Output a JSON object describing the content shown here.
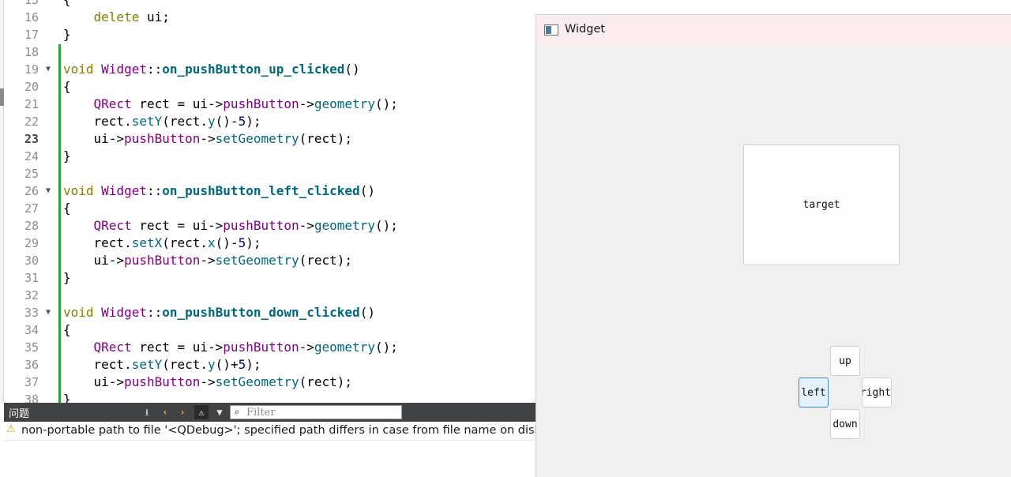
{
  "editor": {
    "current_line": "23",
    "lines": [
      {
        "n": "15",
        "fold": false,
        "tokens": [
          {
            "t": "{",
            "c": "op"
          }
        ]
      },
      {
        "n": "16",
        "fold": false,
        "tokens": [
          {
            "t": "    ",
            "c": "op"
          },
          {
            "t": "delete",
            "c": "kw"
          },
          {
            "t": " ui;",
            "c": "op"
          }
        ]
      },
      {
        "n": "17",
        "fold": false,
        "tokens": [
          {
            "t": "}",
            "c": "op"
          }
        ]
      },
      {
        "n": "18",
        "fold": false,
        "tokens": []
      },
      {
        "n": "19",
        "fold": true,
        "tokens": [
          {
            "t": "void",
            "c": "kw"
          },
          {
            "t": " ",
            "c": "op"
          },
          {
            "t": "Widget",
            "c": "ty"
          },
          {
            "t": "::",
            "c": "op"
          },
          {
            "t": "on_pushButton_up_clicked",
            "c": "fn"
          },
          {
            "t": "()",
            "c": "op"
          }
        ]
      },
      {
        "n": "20",
        "fold": false,
        "tokens": [
          {
            "t": "{",
            "c": "op"
          }
        ]
      },
      {
        "n": "21",
        "fold": false,
        "tokens": [
          {
            "t": "    ",
            "c": "op"
          },
          {
            "t": "QRect",
            "c": "ty"
          },
          {
            "t": " rect = ",
            "c": "op"
          },
          {
            "t": "ui",
            "c": "op"
          },
          {
            "t": "->",
            "c": "op"
          },
          {
            "t": "pushButton",
            "c": "ty"
          },
          {
            "t": "->",
            "c": "op"
          },
          {
            "t": "geometry",
            "c": "me"
          },
          {
            "t": "();",
            "c": "op"
          }
        ]
      },
      {
        "n": "22",
        "fold": false,
        "tokens": [
          {
            "t": "    rect.",
            "c": "op"
          },
          {
            "t": "setY",
            "c": "me"
          },
          {
            "t": "(rect.",
            "c": "op"
          },
          {
            "t": "y",
            "c": "me"
          },
          {
            "t": "()-",
            "c": "op"
          },
          {
            "t": "5",
            "c": "nm"
          },
          {
            "t": ");",
            "c": "op"
          }
        ]
      },
      {
        "n": "23",
        "fold": false,
        "tokens": [
          {
            "t": "    ui->",
            "c": "op"
          },
          {
            "t": "pushButton",
            "c": "ty"
          },
          {
            "t": "->",
            "c": "op"
          },
          {
            "t": "setGeometry",
            "c": "me"
          },
          {
            "t": "(rect);",
            "c": "op"
          }
        ]
      },
      {
        "n": "24",
        "fold": false,
        "tokens": [
          {
            "t": "}",
            "c": "op"
          }
        ]
      },
      {
        "n": "25",
        "fold": false,
        "tokens": []
      },
      {
        "n": "26",
        "fold": true,
        "tokens": [
          {
            "t": "void",
            "c": "kw"
          },
          {
            "t": " ",
            "c": "op"
          },
          {
            "t": "Widget",
            "c": "ty"
          },
          {
            "t": "::",
            "c": "op"
          },
          {
            "t": "on_pushButton_left_clicked",
            "c": "fn"
          },
          {
            "t": "()",
            "c": "op"
          }
        ]
      },
      {
        "n": "27",
        "fold": false,
        "tokens": [
          {
            "t": "{",
            "c": "op"
          }
        ]
      },
      {
        "n": "28",
        "fold": false,
        "tokens": [
          {
            "t": "    ",
            "c": "op"
          },
          {
            "t": "QRect",
            "c": "ty"
          },
          {
            "t": " rect = ",
            "c": "op"
          },
          {
            "t": "ui",
            "c": "op"
          },
          {
            "t": "->",
            "c": "op"
          },
          {
            "t": "pushButton",
            "c": "ty"
          },
          {
            "t": "->",
            "c": "op"
          },
          {
            "t": "geometry",
            "c": "me"
          },
          {
            "t": "();",
            "c": "op"
          }
        ]
      },
      {
        "n": "29",
        "fold": false,
        "tokens": [
          {
            "t": "    rect.",
            "c": "op"
          },
          {
            "t": "setX",
            "c": "me"
          },
          {
            "t": "(rect.",
            "c": "op"
          },
          {
            "t": "x",
            "c": "me"
          },
          {
            "t": "()-",
            "c": "op"
          },
          {
            "t": "5",
            "c": "nm"
          },
          {
            "t": ");",
            "c": "op"
          }
        ]
      },
      {
        "n": "30",
        "fold": false,
        "tokens": [
          {
            "t": "    ui->",
            "c": "op"
          },
          {
            "t": "pushButton",
            "c": "ty"
          },
          {
            "t": "->",
            "c": "op"
          },
          {
            "t": "setGeometry",
            "c": "me"
          },
          {
            "t": "(rect);",
            "c": "op"
          }
        ]
      },
      {
        "n": "31",
        "fold": false,
        "tokens": [
          {
            "t": "}",
            "c": "op"
          }
        ]
      },
      {
        "n": "32",
        "fold": false,
        "tokens": []
      },
      {
        "n": "33",
        "fold": true,
        "tokens": [
          {
            "t": "void",
            "c": "kw"
          },
          {
            "t": " ",
            "c": "op"
          },
          {
            "t": "Widget",
            "c": "ty"
          },
          {
            "t": "::",
            "c": "op"
          },
          {
            "t": "on_pushButton_down_clicked",
            "c": "fn"
          },
          {
            "t": "()",
            "c": "op"
          }
        ]
      },
      {
        "n": "34",
        "fold": false,
        "tokens": [
          {
            "t": "{",
            "c": "op"
          }
        ]
      },
      {
        "n": "35",
        "fold": false,
        "tokens": [
          {
            "t": "    ",
            "c": "op"
          },
          {
            "t": "QRect",
            "c": "ty"
          },
          {
            "t": " rect = ",
            "c": "op"
          },
          {
            "t": "ui",
            "c": "op"
          },
          {
            "t": "->",
            "c": "op"
          },
          {
            "t": "pushButton",
            "c": "ty"
          },
          {
            "t": "->",
            "c": "op"
          },
          {
            "t": "geometry",
            "c": "me"
          },
          {
            "t": "();",
            "c": "op"
          }
        ]
      },
      {
        "n": "36",
        "fold": false,
        "tokens": [
          {
            "t": "    rect.",
            "c": "op"
          },
          {
            "t": "setY",
            "c": "me"
          },
          {
            "t": "(rect.",
            "c": "op"
          },
          {
            "t": "y",
            "c": "me"
          },
          {
            "t": "()+",
            "c": "op"
          },
          {
            "t": "5",
            "c": "nm"
          },
          {
            "t": ");",
            "c": "op"
          }
        ]
      },
      {
        "n": "37",
        "fold": false,
        "tokens": [
          {
            "t": "    ui->",
            "c": "op"
          },
          {
            "t": "pushButton",
            "c": "ty"
          },
          {
            "t": "->",
            "c": "op"
          },
          {
            "t": "setGeometry",
            "c": "me"
          },
          {
            "t": "(rect);",
            "c": "op"
          }
        ]
      },
      {
        "n": "38",
        "fold": false,
        "tokens": [
          {
            "t": "}",
            "c": "op"
          }
        ]
      }
    ],
    "colors": {
      "keyword": "#808000",
      "type": "#800080",
      "function": "#00677c",
      "number": "#000080",
      "change_marker": "#25a53a"
    }
  },
  "issues": {
    "title": "问题",
    "filter_placeholder": "Filter",
    "toolbar_icons": [
      "build-issues-icon",
      "prev-icon",
      "next-icon",
      "warning-filter-icon",
      "filter-icon"
    ],
    "items": [
      {
        "severity": "warning",
        "message": "non-portable path to file '<QDebug>'; specified path differs in case from file name on disk"
      }
    ]
  },
  "widget_window": {
    "title": "Widget",
    "buttons": {
      "target": "target",
      "up": "up",
      "left": "left",
      "right": "right",
      "down": "down"
    },
    "focused_button": "left"
  }
}
